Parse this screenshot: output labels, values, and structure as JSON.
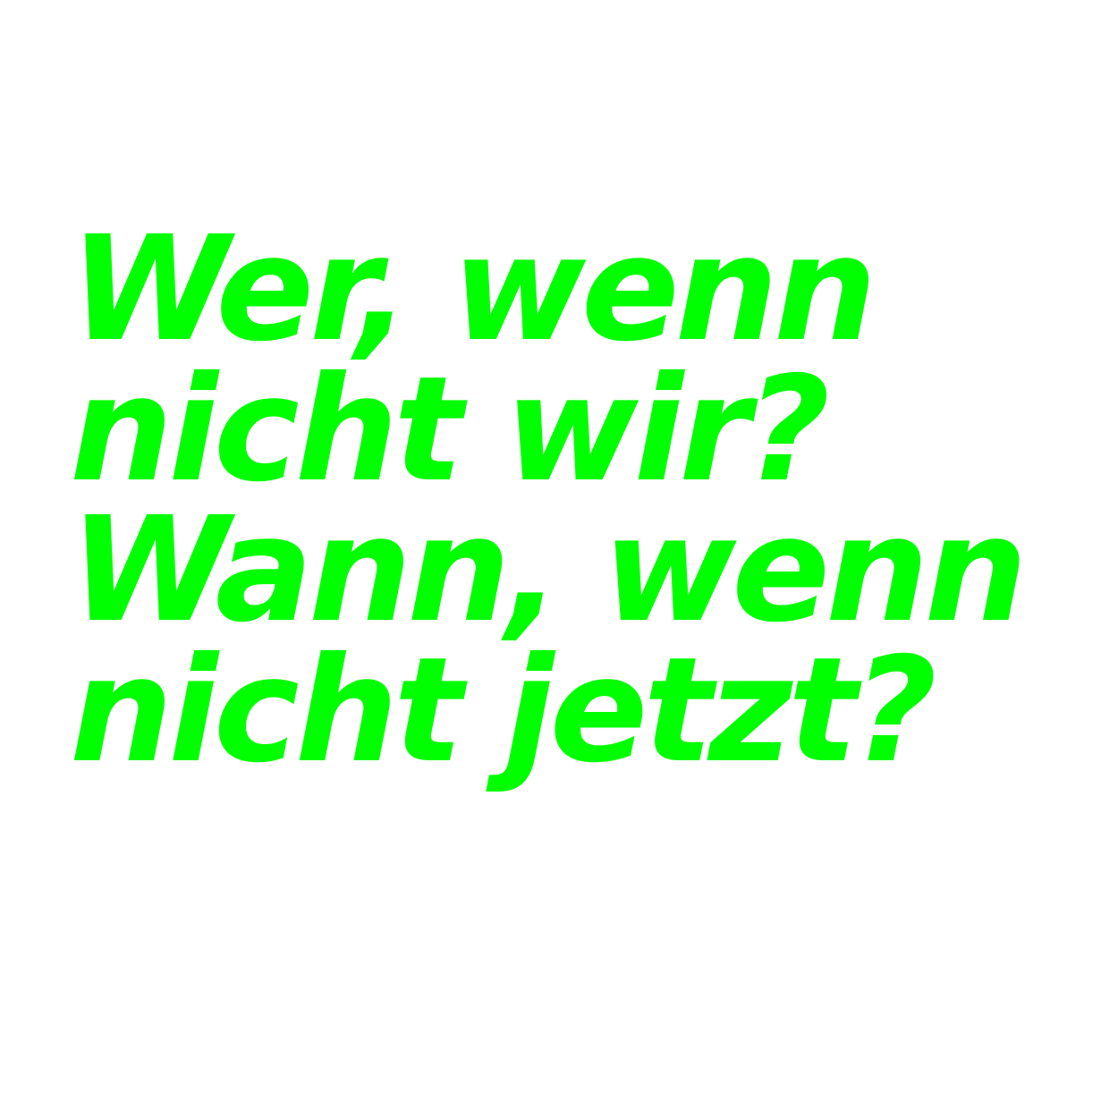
{
  "background_color": "#ffffff",
  "text_color": "#00ff00",
  "quote": {
    "lines": [
      "Wer, wenn",
      "nicht wir?",
      "Wann, wenn",
      "nicht jetzt?"
    ]
  }
}
